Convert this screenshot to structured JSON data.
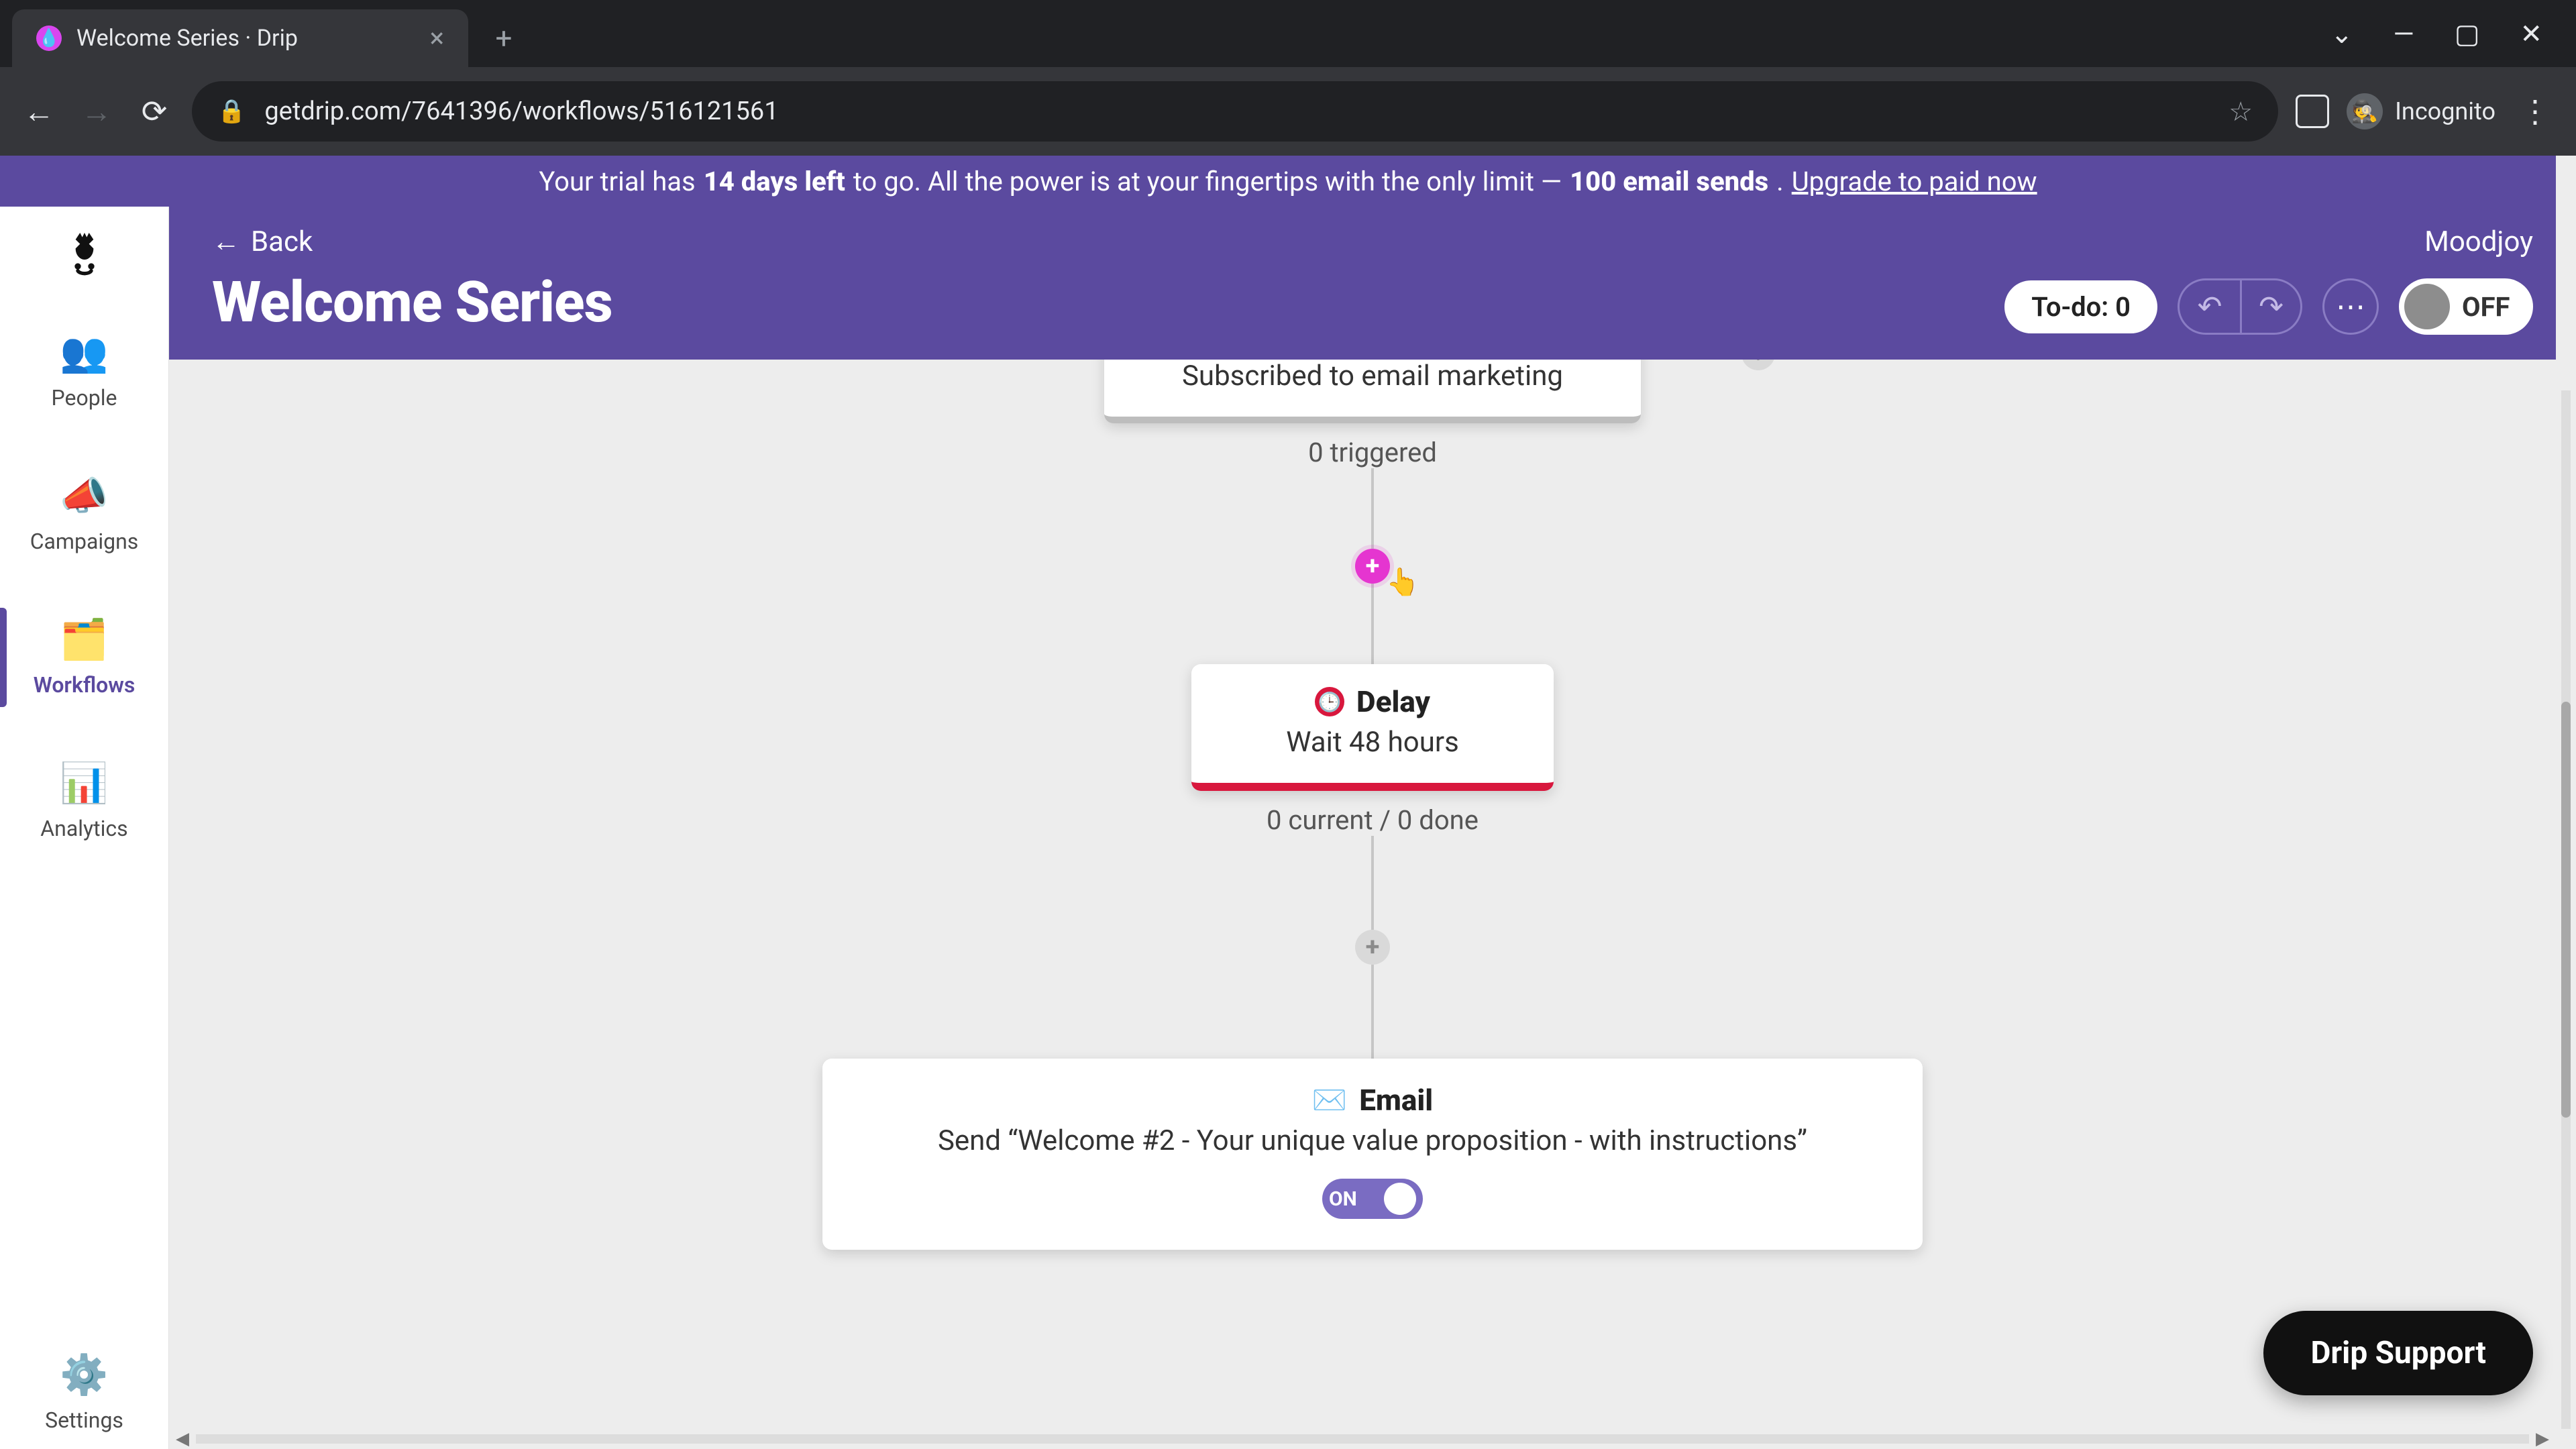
{
  "browser": {
    "tab_title": "Welcome Series · Drip",
    "url": "getdrip.com/7641396/workflows/516121561",
    "incognito_label": "Incognito"
  },
  "banner": {
    "prefix": "Your trial has ",
    "days_bold": "14 days left",
    "middle": " to go. All the power is at your fingertips with the only limit — ",
    "sends_bold": "100 email sends",
    "suffix": ". ",
    "upgrade_link": "Upgrade to paid now"
  },
  "rail": {
    "people": "People",
    "campaigns": "Campaigns",
    "workflows": "Workflows",
    "analytics": "Analytics",
    "settings": "Settings"
  },
  "header": {
    "back": "Back",
    "title": "Welcome Series",
    "workspace": "Moodjoy",
    "todo": "To-do: 0",
    "toggle_state": "OFF"
  },
  "flow": {
    "trigger": {
      "sub": "Subscribed to email marketing",
      "stat": "0 triggered"
    },
    "delay": {
      "title": "Delay",
      "sub": "Wait 48 hours",
      "stat": "0 current / 0 done"
    },
    "email": {
      "title": "Email",
      "sub": "Send “Welcome #2 - Your unique value proposition - with instructions”",
      "toggle": "ON"
    }
  },
  "support": {
    "label": "Drip Support"
  }
}
